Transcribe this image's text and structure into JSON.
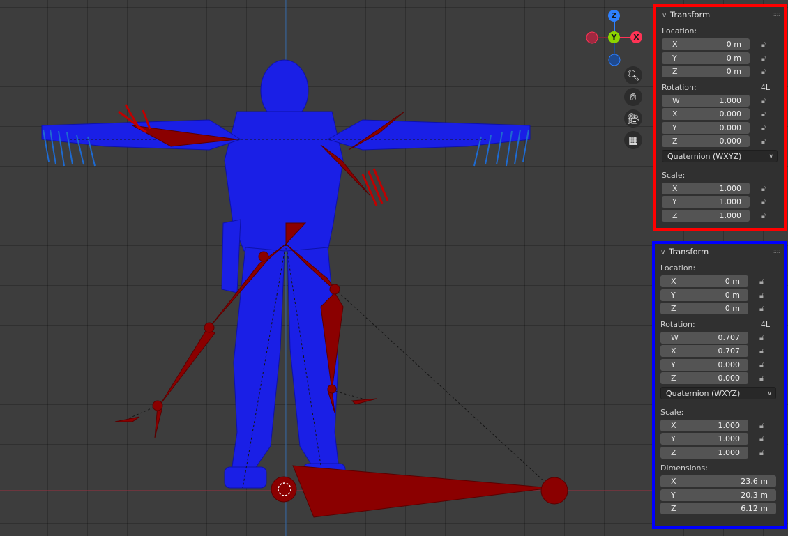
{
  "colors": {
    "selection_box_top": "#ff0000",
    "selection_box_bottom": "#0000ff",
    "mesh": "#1a1fe6",
    "bones": "#8b0000",
    "axis_x": "#ff3355",
    "axis_y": "#8cd400",
    "axis_z": "#2e80ff"
  },
  "gizmo": {
    "z": "Z",
    "y": "Y",
    "x": "X"
  },
  "tools": [
    "zoom-icon",
    "hand-pan-icon",
    "camera-icon",
    "grid-icon"
  ],
  "panel_top": {
    "title": "Transform",
    "location_label": "Location:",
    "location": [
      {
        "axis": "X",
        "value": "0 m"
      },
      {
        "axis": "Y",
        "value": "0 m"
      },
      {
        "axis": "Z",
        "value": "0 m"
      }
    ],
    "rotation_label": "Rotation:",
    "rotation_lock_mode": "4L",
    "rotation": [
      {
        "axis": "W",
        "value": "1.000"
      },
      {
        "axis": "X",
        "value": "0.000"
      },
      {
        "axis": "Y",
        "value": "0.000"
      },
      {
        "axis": "Z",
        "value": "0.000"
      }
    ],
    "rotation_mode": "Quaternion (WXYZ)",
    "scale_label": "Scale:",
    "scale": [
      {
        "axis": "X",
        "value": "1.000"
      },
      {
        "axis": "Y",
        "value": "1.000"
      },
      {
        "axis": "Z",
        "value": "1.000"
      }
    ]
  },
  "panel_bottom": {
    "title": "Transform",
    "location_label": "Location:",
    "location": [
      {
        "axis": "X",
        "value": "0 m"
      },
      {
        "axis": "Y",
        "value": "0 m"
      },
      {
        "axis": "Z",
        "value": "0 m"
      }
    ],
    "rotation_label": "Rotation:",
    "rotation_lock_mode": "4L",
    "rotation": [
      {
        "axis": "W",
        "value": "0.707"
      },
      {
        "axis": "X",
        "value": "0.707"
      },
      {
        "axis": "Y",
        "value": "0.000"
      },
      {
        "axis": "Z",
        "value": "0.000"
      }
    ],
    "rotation_mode": "Quaternion (WXYZ)",
    "scale_label": "Scale:",
    "scale": [
      {
        "axis": "X",
        "value": "1.000"
      },
      {
        "axis": "Y",
        "value": "1.000"
      },
      {
        "axis": "Z",
        "value": "1.000"
      }
    ],
    "dimensions_label": "Dimensions:",
    "dimensions": [
      {
        "axis": "X",
        "value": "23.6 m"
      },
      {
        "axis": "Y",
        "value": "20.3 m"
      },
      {
        "axis": "Z",
        "value": "6.12 m"
      }
    ]
  }
}
